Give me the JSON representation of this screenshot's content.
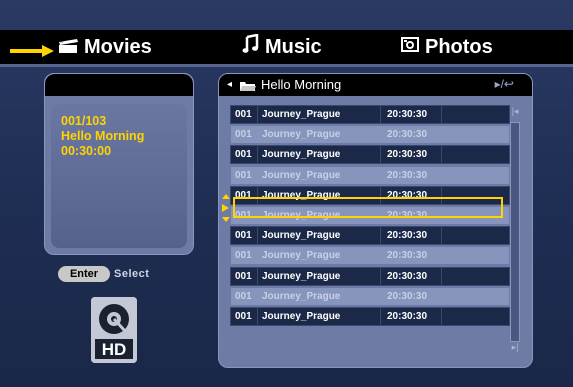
{
  "topbar": {
    "items": [
      {
        "label": "Movies",
        "icon": "clapperboard-icon",
        "selected": true
      },
      {
        "label": "Music",
        "icon": "music-note-icon",
        "selected": false
      },
      {
        "label": "Photos",
        "icon": "camera-icon",
        "selected": false
      }
    ]
  },
  "info": {
    "index": "001/103",
    "title": "Hello Morning",
    "duration": "00:30:00"
  },
  "help": {
    "enter": "Enter",
    "select": "Select"
  },
  "playlist": {
    "folder": "Hello Morning",
    "nav_hint": "▸/↩",
    "rows": [
      {
        "num": "001",
        "name": "Journey_Prague",
        "time": "20:30:30",
        "style": "dark"
      },
      {
        "num": "001",
        "name": "Journey_Prague",
        "time": "20:30:30",
        "style": "light"
      },
      {
        "num": "001",
        "name": "Journey_Prague",
        "time": "20:30:30",
        "style": "dark"
      },
      {
        "num": "001",
        "name": "Journey_Prague",
        "time": "20:30:30",
        "style": "light"
      },
      {
        "num": "001",
        "name": "Journey_Prague",
        "time": "20:30:30",
        "style": "selected"
      },
      {
        "num": "001",
        "name": "Journey_Prague",
        "time": "20:30:30",
        "style": "light"
      },
      {
        "num": "001",
        "name": "Journey_Prague",
        "time": "20:30:30",
        "style": "dark"
      },
      {
        "num": "001",
        "name": "Journey_Prague",
        "time": "20:30:30",
        "style": "light"
      },
      {
        "num": "001",
        "name": "Journey_Prague",
        "time": "20:30:30",
        "style": "dark"
      },
      {
        "num": "001",
        "name": "Journey_Prague",
        "time": "20:30:30",
        "style": "light"
      },
      {
        "num": "001",
        "name": "Journey_Prague",
        "time": "20:30:30",
        "style": "dark"
      }
    ]
  },
  "colors": {
    "accent": "#ffd400",
    "panel": "#6e7ba4",
    "row_dark": "#1b2847"
  }
}
